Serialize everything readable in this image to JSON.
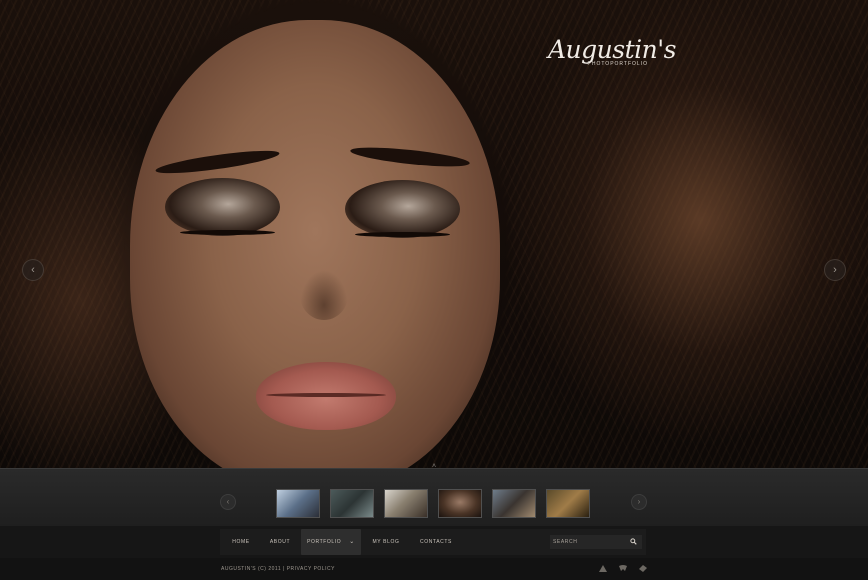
{
  "logo": {
    "name": "Augustin's",
    "tagline": "PHOTOPORTFOLIO"
  },
  "slider": {
    "prev_glyph": "‹",
    "next_glyph": "›",
    "image": "portrait-woman-closed-eyes"
  },
  "thumbnails": {
    "toggle_glyph": "˄",
    "prev_glyph": "‹",
    "next_glyph": "›",
    "items": [
      "thumb-1",
      "thumb-2",
      "thumb-3",
      "thumb-4",
      "thumb-5",
      "thumb-6"
    ]
  },
  "nav": {
    "items": [
      {
        "label": "HOME"
      },
      {
        "label": "ABOUT"
      },
      {
        "label": "PORTFOLIO",
        "chevron": "⌄"
      },
      {
        "label": "MY BLOG"
      },
      {
        "label": "CONTACTS"
      }
    ],
    "search": {
      "placeholder": "SEARCH",
      "value": ""
    }
  },
  "footer": {
    "copyright": "AUGUSTIN'S (C) 2011",
    "separator": "|",
    "privacy": "PRIVACY POLICY",
    "social_icons": [
      "rss-icon",
      "twitter-icon",
      "delicious-icon"
    ]
  },
  "colors": {
    "background": "#0b0908",
    "strip": "#242424",
    "navbar": "#161616",
    "footer": "#121212",
    "text": "#c9c3bb"
  }
}
